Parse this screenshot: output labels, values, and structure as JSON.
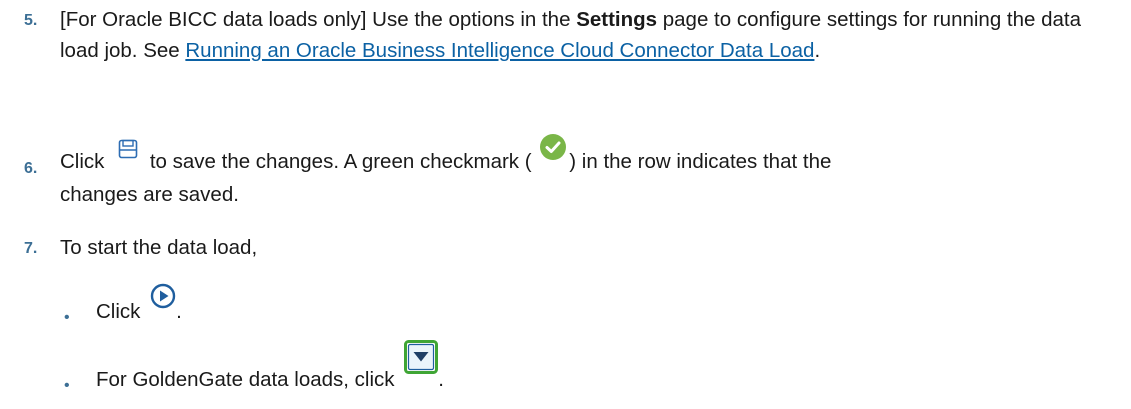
{
  "steps": [
    {
      "number": "5.",
      "prefix": "[For Oracle BICC data loads only] Use the options in the ",
      "bold": "Settings",
      "mid": " page to configure settings for running the data load job. See ",
      "link": "Running an Oracle Business Intelligence Cloud Connector Data Load",
      "suffix": "."
    },
    {
      "number": "6.",
      "before_icon": "Click",
      "after_icon": "to save the changes. A green checkmark (",
      "after_check": ") in the row indicates that the",
      "line2": "changes are saved.",
      "save_icon": "save-icon",
      "check_icon": "green-checkmark-icon"
    },
    {
      "number": "7.",
      "text": "To start the data load,"
    }
  ],
  "bullets": [
    {
      "marker": "•",
      "text": "Click",
      "suffix": ".",
      "icon": "run-icon"
    },
    {
      "marker": "•",
      "text": "For GoldenGate data loads, click",
      "suffix": ".",
      "icon": "dropdown-icon"
    }
  ],
  "colors": {
    "step_number": "#3c6f95",
    "link": "#0b61a4",
    "check_green": "#7ab648",
    "dropdown_green": "#3fa535"
  }
}
